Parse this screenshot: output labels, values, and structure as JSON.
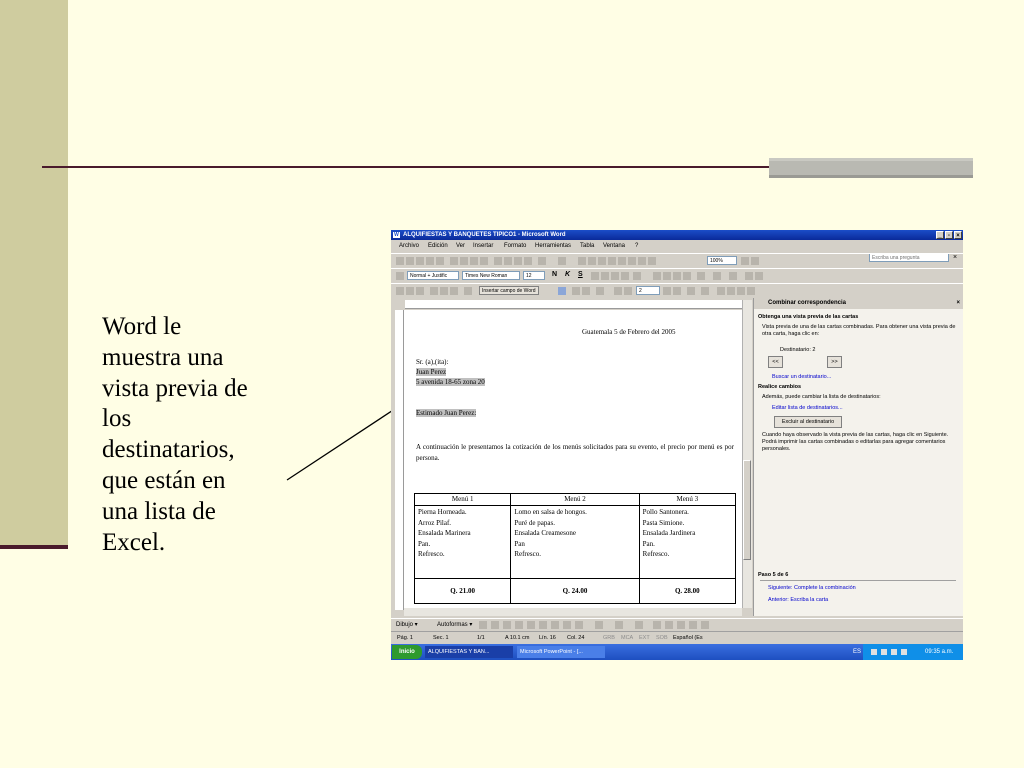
{
  "slide": {
    "caption_lines": [
      "Word le",
      "muestra una",
      "vista previa de",
      "los",
      "destinatarios,",
      "que están en",
      "una lista de",
      "Excel."
    ],
    "colors": {
      "background": "#FFFEE5",
      "side_bar": "#CFCC9F",
      "rule": "#4A1A2C",
      "tab": "#B9B9B2"
    }
  },
  "window": {
    "title": "ALQUIFIESTAS Y BANQUETES TIPICO1 - Microsoft Word",
    "controls": [
      "_",
      "▫",
      "×"
    ]
  },
  "menu": {
    "items": [
      "Archivo",
      "Edición",
      "Ver",
      "Insertar",
      "Formato",
      "Herramientas",
      "Tabla",
      "Ventana",
      "?"
    ],
    "help_placeholder": "Escriba una pregunta",
    "close": "×"
  },
  "toolbar": {
    "zoom": "100%",
    "style": "Normal + Justific",
    "font": "Times New Roman",
    "size": "12",
    "bold": "N",
    "italic": "K",
    "underline": "S",
    "merge_field": "Insertar campo de Word",
    "record": "2"
  },
  "document": {
    "date": "Guatemala 5 de Febrero del 2005",
    "salutation_lines": [
      "Sr. (a),(ita):",
      "Juan Perez",
      "5 avenida 18-65 zona 20"
    ],
    "greeting": "Estimado Juan Perez:",
    "paragraph": "A continuación le presentamos la cotización de los menús solicitados para su evento, el precio por menú es por persona.",
    "table": {
      "headers": [
        "Menú 1",
        "Menú 2",
        "Menú 3"
      ],
      "items": [
        [
          "Pierna Horneada.",
          "Arroz Pilaf.",
          "Ensalada Marinera",
          "Pan.",
          "Refresco."
        ],
        [
          "Lomo en salsa de hongos.",
          "Puré de papas.",
          "Ensalada Creamesone",
          "Pan",
          "Refresco."
        ],
        [
          "Pollo Santonera.",
          "Pasta Simione.",
          "Ensalada Jardinera",
          "Pan.",
          "Refresco."
        ]
      ],
      "prices": [
        "Q. 21.00",
        "Q. 24.00",
        "Q. 28.00"
      ]
    }
  },
  "pane": {
    "title": "Combinar correspondencia",
    "section1": "Obtenga una vista previa de las cartas",
    "section1_text": "Vista previa de una de las cartas combinadas. Para obtener una vista previa de otra carta, haga clic en:",
    "recipient_label": "Destinatario: 2",
    "prev": "<<",
    "next": ">>",
    "find_link": "Buscar un destinatario...",
    "section2": "Realice cambios",
    "section2_text": "Además, puede cambiar la lista de destinatarios:",
    "edit_link": "Editar lista de destinatarios...",
    "exclude_button": "Excluir al destinatario",
    "info_text": "Cuando haya observado la vista previa de las cartas, haga clic en Siguiente. Podrá imprimir las cartas combinadas o editarlas para agregar comentarios personales.",
    "step": "Paso 5 de 6",
    "next_link": "Siguiente: Complete la combinación",
    "prev_link": "Anterior: Escriba la carta"
  },
  "drawing": {
    "draw": "Dibujo ▾",
    "autoshapes": "Autoformas ▾"
  },
  "status": {
    "page": "Pág. 1",
    "section": "Sec. 1",
    "pages": "1/1",
    "at": "A 10.1 cm",
    "line": "Lín. 16",
    "col": "Col. 24",
    "grb": "GRB",
    "mca": "MCA",
    "ext": "EXT",
    "sob": "SOB",
    "lang": "Español (Es"
  },
  "taskbar": {
    "start": "Inicio",
    "tasks": [
      "ALQUIFIESTAS Y BAN...",
      "Microsoft PowerPoint - [..."
    ],
    "lang": "ES",
    "clock": "09:35 a.m."
  }
}
